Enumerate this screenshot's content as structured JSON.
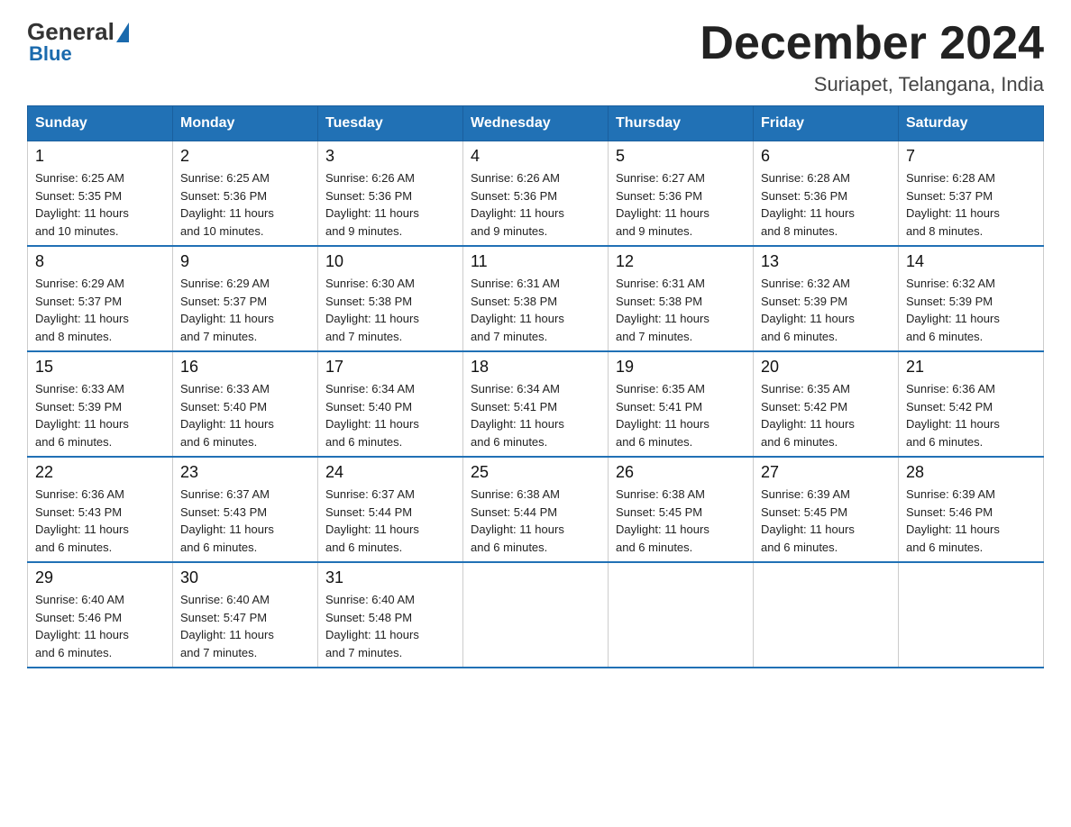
{
  "logo": {
    "general": "General",
    "blue": "Blue"
  },
  "header": {
    "title": "December 2024",
    "subtitle": "Suriapet, Telangana, India"
  },
  "days_of_week": [
    "Sunday",
    "Monday",
    "Tuesday",
    "Wednesday",
    "Thursday",
    "Friday",
    "Saturday"
  ],
  "weeks": [
    [
      {
        "num": "1",
        "sunrise": "6:25 AM",
        "sunset": "5:35 PM",
        "daylight": "11 hours and 10 minutes."
      },
      {
        "num": "2",
        "sunrise": "6:25 AM",
        "sunset": "5:36 PM",
        "daylight": "11 hours and 10 minutes."
      },
      {
        "num": "3",
        "sunrise": "6:26 AM",
        "sunset": "5:36 PM",
        "daylight": "11 hours and 9 minutes."
      },
      {
        "num": "4",
        "sunrise": "6:26 AM",
        "sunset": "5:36 PM",
        "daylight": "11 hours and 9 minutes."
      },
      {
        "num": "5",
        "sunrise": "6:27 AM",
        "sunset": "5:36 PM",
        "daylight": "11 hours and 9 minutes."
      },
      {
        "num": "6",
        "sunrise": "6:28 AM",
        "sunset": "5:36 PM",
        "daylight": "11 hours and 8 minutes."
      },
      {
        "num": "7",
        "sunrise": "6:28 AM",
        "sunset": "5:37 PM",
        "daylight": "11 hours and 8 minutes."
      }
    ],
    [
      {
        "num": "8",
        "sunrise": "6:29 AM",
        "sunset": "5:37 PM",
        "daylight": "11 hours and 8 minutes."
      },
      {
        "num": "9",
        "sunrise": "6:29 AM",
        "sunset": "5:37 PM",
        "daylight": "11 hours and 7 minutes."
      },
      {
        "num": "10",
        "sunrise": "6:30 AM",
        "sunset": "5:38 PM",
        "daylight": "11 hours and 7 minutes."
      },
      {
        "num": "11",
        "sunrise": "6:31 AM",
        "sunset": "5:38 PM",
        "daylight": "11 hours and 7 minutes."
      },
      {
        "num": "12",
        "sunrise": "6:31 AM",
        "sunset": "5:38 PM",
        "daylight": "11 hours and 7 minutes."
      },
      {
        "num": "13",
        "sunrise": "6:32 AM",
        "sunset": "5:39 PM",
        "daylight": "11 hours and 6 minutes."
      },
      {
        "num": "14",
        "sunrise": "6:32 AM",
        "sunset": "5:39 PM",
        "daylight": "11 hours and 6 minutes."
      }
    ],
    [
      {
        "num": "15",
        "sunrise": "6:33 AM",
        "sunset": "5:39 PM",
        "daylight": "11 hours and 6 minutes."
      },
      {
        "num": "16",
        "sunrise": "6:33 AM",
        "sunset": "5:40 PM",
        "daylight": "11 hours and 6 minutes."
      },
      {
        "num": "17",
        "sunrise": "6:34 AM",
        "sunset": "5:40 PM",
        "daylight": "11 hours and 6 minutes."
      },
      {
        "num": "18",
        "sunrise": "6:34 AM",
        "sunset": "5:41 PM",
        "daylight": "11 hours and 6 minutes."
      },
      {
        "num": "19",
        "sunrise": "6:35 AM",
        "sunset": "5:41 PM",
        "daylight": "11 hours and 6 minutes."
      },
      {
        "num": "20",
        "sunrise": "6:35 AM",
        "sunset": "5:42 PM",
        "daylight": "11 hours and 6 minutes."
      },
      {
        "num": "21",
        "sunrise": "6:36 AM",
        "sunset": "5:42 PM",
        "daylight": "11 hours and 6 minutes."
      }
    ],
    [
      {
        "num": "22",
        "sunrise": "6:36 AM",
        "sunset": "5:43 PM",
        "daylight": "11 hours and 6 minutes."
      },
      {
        "num": "23",
        "sunrise": "6:37 AM",
        "sunset": "5:43 PM",
        "daylight": "11 hours and 6 minutes."
      },
      {
        "num": "24",
        "sunrise": "6:37 AM",
        "sunset": "5:44 PM",
        "daylight": "11 hours and 6 minutes."
      },
      {
        "num": "25",
        "sunrise": "6:38 AM",
        "sunset": "5:44 PM",
        "daylight": "11 hours and 6 minutes."
      },
      {
        "num": "26",
        "sunrise": "6:38 AM",
        "sunset": "5:45 PM",
        "daylight": "11 hours and 6 minutes."
      },
      {
        "num": "27",
        "sunrise": "6:39 AM",
        "sunset": "5:45 PM",
        "daylight": "11 hours and 6 minutes."
      },
      {
        "num": "28",
        "sunrise": "6:39 AM",
        "sunset": "5:46 PM",
        "daylight": "11 hours and 6 minutes."
      }
    ],
    [
      {
        "num": "29",
        "sunrise": "6:40 AM",
        "sunset": "5:46 PM",
        "daylight": "11 hours and 6 minutes."
      },
      {
        "num": "30",
        "sunrise": "6:40 AM",
        "sunset": "5:47 PM",
        "daylight": "11 hours and 7 minutes."
      },
      {
        "num": "31",
        "sunrise": "6:40 AM",
        "sunset": "5:48 PM",
        "daylight": "11 hours and 7 minutes."
      },
      null,
      null,
      null,
      null
    ]
  ],
  "labels": {
    "sunrise": "Sunrise:",
    "sunset": "Sunset:",
    "daylight": "Daylight:"
  }
}
